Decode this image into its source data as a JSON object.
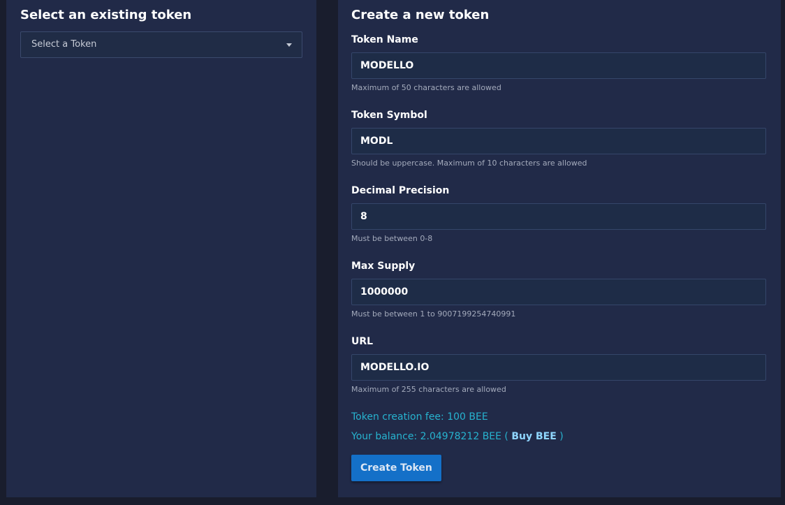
{
  "left_panel": {
    "title": "Select an existing token",
    "select": {
      "placeholder": "Select a Token"
    }
  },
  "right_panel": {
    "title": "Create a new token",
    "fields": [
      {
        "label": "Token Name",
        "value": "MODELLO",
        "help": "Maximum of 50 characters are allowed"
      },
      {
        "label": "Token Symbol",
        "value": "MODL",
        "help": "Should be uppercase. Maximum of 10 characters are allowed"
      },
      {
        "label": "Decimal Precision",
        "value": "8",
        "help": "Must be between 0-8"
      },
      {
        "label": "Max Supply",
        "value": "1000000",
        "help": "Must be between 1 to 9007199254740991"
      },
      {
        "label": "URL",
        "value": "MODELLO.IO",
        "help": "Maximum of 255 characters are allowed"
      }
    ],
    "fee_text": "Token creation fee: 100 BEE",
    "balance_prefix": "Your balance: 2.04978212 BEE (",
    "buy_link": "Buy BEE",
    "balance_suffix": ")",
    "create_button": "Create Token"
  },
  "colors": {
    "background": "#191d2d",
    "panel": "#212a48",
    "accent_text": "#27b3cf",
    "button": "#1470c8"
  },
  "icons": {
    "select_caret": "caret-down-icon"
  }
}
